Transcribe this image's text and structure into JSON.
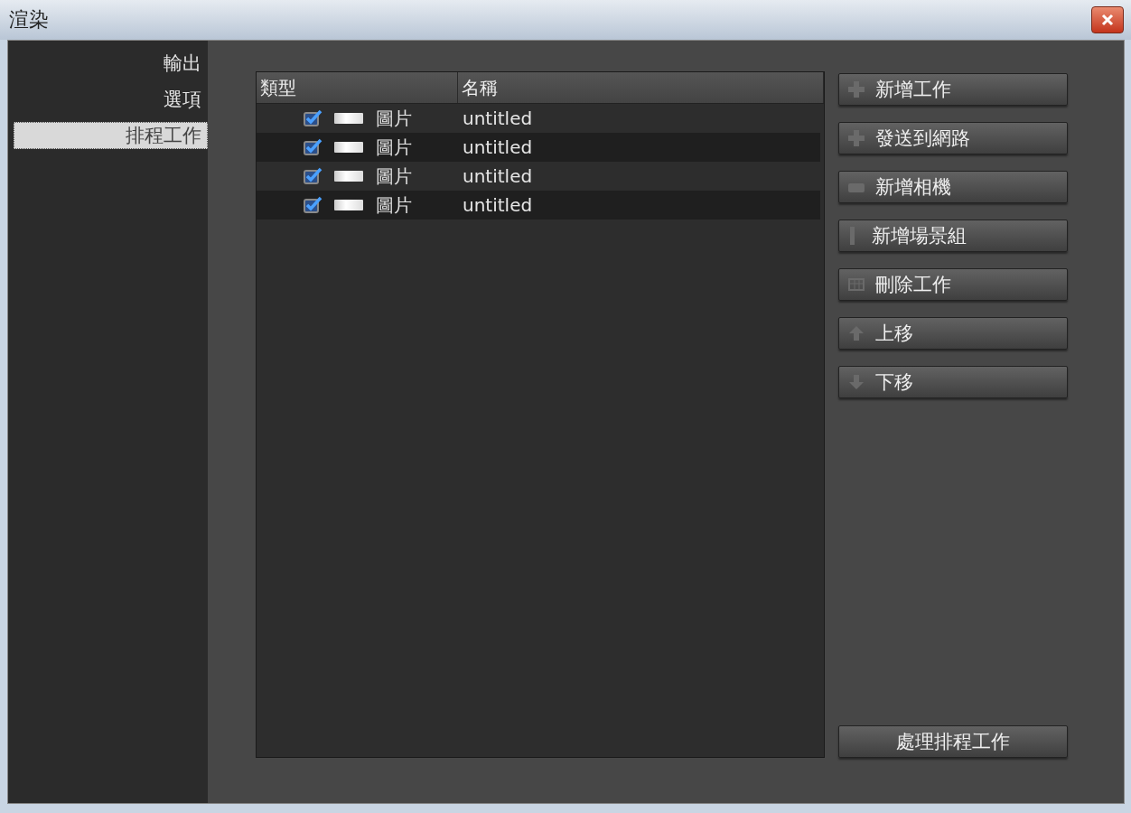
{
  "window": {
    "title": "渲染"
  },
  "sidebar": {
    "items": [
      {
        "label": "輸出",
        "selected": false
      },
      {
        "label": "選項",
        "selected": false
      },
      {
        "label": "排程工作",
        "selected": true
      }
    ]
  },
  "table": {
    "columns": [
      "類型",
      "名稱"
    ],
    "rows": [
      {
        "checked": true,
        "type": "圖片",
        "name": "untitled"
      },
      {
        "checked": true,
        "type": "圖片",
        "name": "untitled"
      },
      {
        "checked": true,
        "type": "圖片",
        "name": "untitled"
      },
      {
        "checked": true,
        "type": "圖片",
        "name": "untitled"
      }
    ]
  },
  "buttons": [
    {
      "kind": "add",
      "label": "新增工作"
    },
    {
      "kind": "send",
      "label": "發送到網路"
    },
    {
      "kind": "camera",
      "label": "新增相機"
    },
    {
      "kind": "scene",
      "label": "新增場景組"
    },
    {
      "kind": "delete",
      "label": "刪除工作"
    },
    {
      "kind": "up",
      "label": "上移"
    },
    {
      "kind": "down",
      "label": "下移"
    }
  ],
  "footer_button": {
    "label": "處理排程工作"
  }
}
